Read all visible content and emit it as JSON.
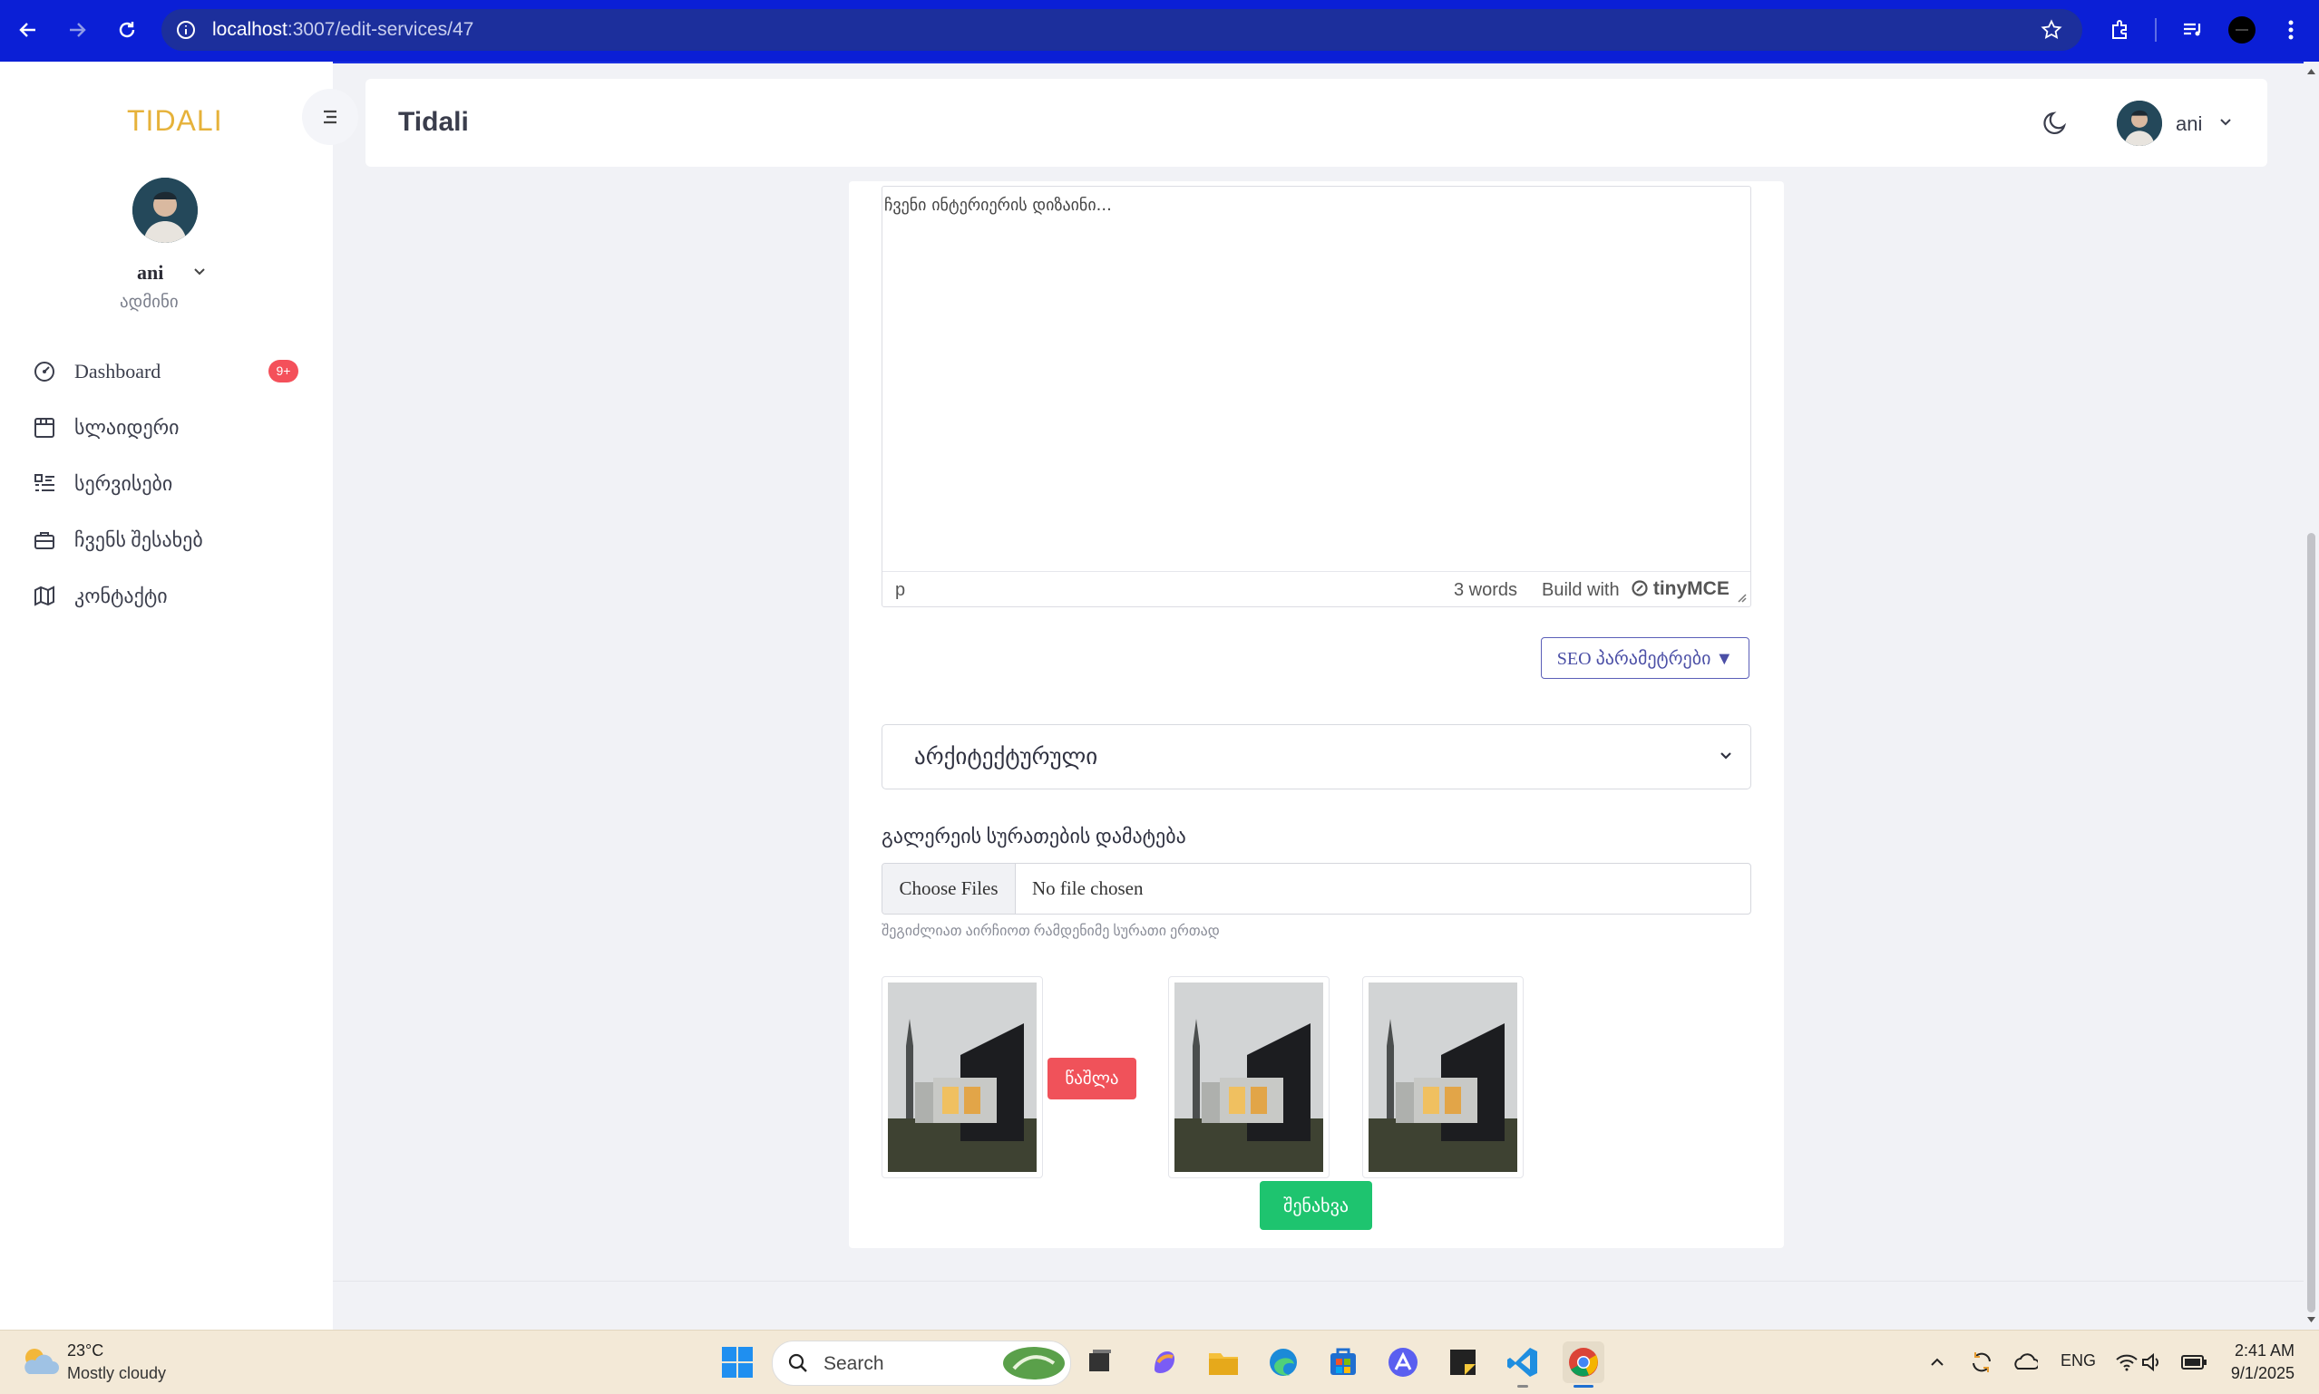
{
  "browser": {
    "url_host": "localhost",
    "url_path": ":3007/edit-services/47"
  },
  "sidebar": {
    "logo": "TIDALI",
    "username": "ani",
    "role": "ადმინი",
    "badge": "9+",
    "items": [
      {
        "label": "Dashboard",
        "icon": "dashboard-icon"
      },
      {
        "label": "სლაიდერი",
        "icon": "slider-icon"
      },
      {
        "label": "სერვისები",
        "icon": "list-icon"
      },
      {
        "label": "ჩვენს შესახებ",
        "icon": "briefcase-icon"
      },
      {
        "label": "კონტაქტი",
        "icon": "map-icon"
      }
    ]
  },
  "header": {
    "title": "Tidali",
    "username": "ani"
  },
  "editor": {
    "content": "ჩვენი ინტერიერის დიზაინი...",
    "status_tag": "p",
    "word_count": "3 words",
    "build_with": "Build with",
    "brand": "tinyMCE"
  },
  "seo_button": "SEO პარამეტრები ▼",
  "category_select": {
    "value": "არქიტექტურული"
  },
  "gallery": {
    "label": "გალერეის სურათების დამატება",
    "choose_files": "Choose Files",
    "file_status": "No file chosen",
    "hint": "შეგიძლიათ აირჩიოთ რამდენიმე სურათი ერთად",
    "delete_label": "წაშლა"
  },
  "save_label": "შენახვა",
  "taskbar": {
    "temperature": "23°C",
    "weather": "Mostly cloudy",
    "search_placeholder": "Search",
    "language": "ENG",
    "time": "2:41 AM",
    "date": "9/1/2025"
  },
  "colors": {
    "browser_bar": "#0b1fd6",
    "delete": "#f0525a",
    "save": "#1ec46f",
    "badge": "#f4505a",
    "seo_border": "#5b5fb8"
  }
}
